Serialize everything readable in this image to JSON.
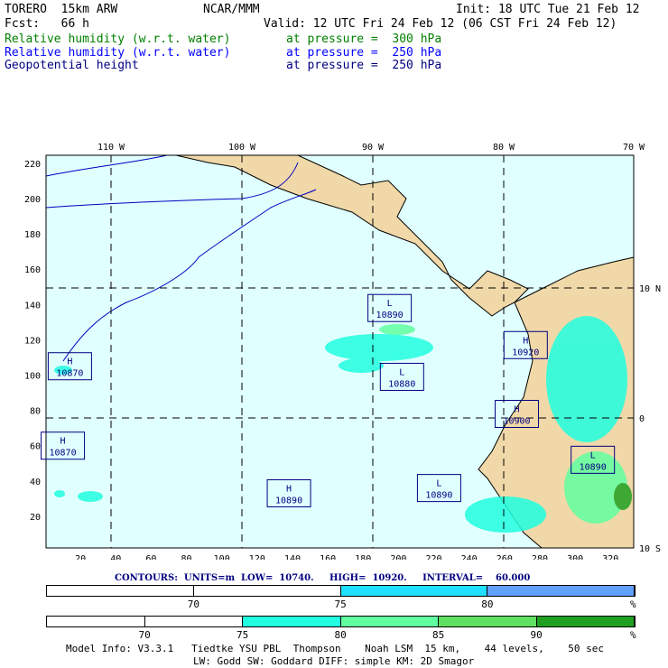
{
  "header": {
    "model": "TORERO  15km ARW",
    "org": "NCAR/MMM",
    "init": "Init: 18 UTC Tue 21 Feb 12",
    "fcst": "Fcst:   66 h",
    "valid": "Valid: 12 UTC Fri 24 Feb 12 (06 CST Fri 24 Feb 12)"
  },
  "fields": [
    {
      "name": "Relative humidity (w.r.t. water)",
      "level": "at pressure =  300 hPa",
      "color": "#008000"
    },
    {
      "name": "Relative humidity (w.r.t. water)",
      "level": "at pressure =  250 hPa",
      "color": "#0000ff"
    },
    {
      "name": "Geopotential height",
      "level": "at pressure =  250 hPa",
      "color": "#000080"
    }
  ],
  "map": {
    "top_labels": [
      "110 W",
      "100 W",
      "90 W",
      "80 W",
      "70 W"
    ],
    "right_labels": [
      "10 N",
      "0",
      "10 S"
    ],
    "y_ticks": [
      "220",
      "200",
      "180",
      "160",
      "140",
      "120",
      "100",
      "80",
      "60",
      "40",
      "20"
    ],
    "x_ticks": [
      "20",
      "40",
      "60",
      "80",
      "100",
      "120",
      "140",
      "160",
      "180",
      "200",
      "220",
      "240",
      "260",
      "280",
      "300",
      "320"
    ],
    "centers": [
      {
        "type": "L",
        "value": "10890",
        "gx": 195,
        "gy": 138
      },
      {
        "type": "H",
        "value": "10920",
        "gx": 272,
        "gy": 117
      },
      {
        "type": "H",
        "value": "10870",
        "gx": 14,
        "gy": 105
      },
      {
        "type": "L",
        "value": "10880",
        "gx": 202,
        "gy": 99
      },
      {
        "type": "H",
        "value": "10900",
        "gx": 267,
        "gy": 78
      },
      {
        "type": "H",
        "value": "10870",
        "gx": 10,
        "gy": 60
      },
      {
        "type": "L",
        "value": "10890",
        "gx": 310,
        "gy": 52
      },
      {
        "type": "L",
        "value": "10890",
        "gx": 223,
        "gy": 36
      },
      {
        "type": "H",
        "value": "10890",
        "gx": 138,
        "gy": 33
      }
    ]
  },
  "contours": "CONTOURS:  UNITS=m  LOW=  10740.     HIGH=  10920.     INTERVAL=    60.000",
  "bar1": {
    "labels": [
      "70",
      "75",
      "80",
      "%"
    ],
    "colors": [
      "#ffffff",
      "#ffffff",
      "#20e0ff",
      "#60a0ff"
    ]
  },
  "bar2": {
    "labels": [
      "70",
      "75",
      "80",
      "85",
      "90",
      "%"
    ],
    "colors": [
      "#ffffff",
      "#ffffff",
      "#20ffe0",
      "#60ffa0",
      "#60e060",
      "#20a020"
    ]
  },
  "footer": {
    "line1": "Model Info: V3.3.1   Tiedtke YSU PBL  Thompson    Noah LSM  15 km,    44 levels,    50 sec",
    "line2": "LW: Godd SW: Goddard DIFF: simple KM: 2D Smagor"
  }
}
